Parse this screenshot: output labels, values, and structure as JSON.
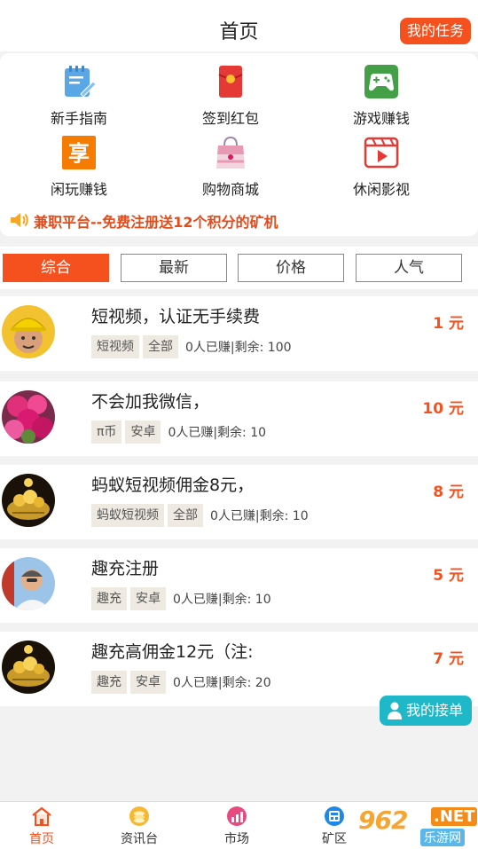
{
  "header": {
    "title": "首页",
    "task_button": "我的任务"
  },
  "menu": {
    "items": [
      {
        "label": "新手指南",
        "icon": "guide-icon"
      },
      {
        "label": "签到红包",
        "icon": "red-envelope-icon"
      },
      {
        "label": "游戏赚钱",
        "icon": "gamepad-icon"
      },
      {
        "label": "闲玩赚钱",
        "icon": "enjoy-icon"
      },
      {
        "label": "购物商城",
        "icon": "shopping-bag-icon"
      },
      {
        "label": "休闲影视",
        "icon": "video-icon"
      }
    ],
    "enjoy_glyph": "享"
  },
  "announcement": "兼职平台--免费注册送12个积分的矿机",
  "filters": {
    "tabs": [
      "综合",
      "最新",
      "价格",
      "人气"
    ],
    "active": "综合"
  },
  "tasks": [
    {
      "title": "短视频，认证无手续费",
      "price": "1 元",
      "tags": [
        "短视频",
        "全部"
      ],
      "stat": "0人已赚|剩余: 100"
    },
    {
      "title": "不会加我微信，",
      "price": "10 元",
      "tags": [
        "π币",
        "安卓"
      ],
      "stat": "0人已赚|剩余: 10"
    },
    {
      "title": "蚂蚁短视频佣金8元，",
      "price": "8 元",
      "tags": [
        "蚂蚁短视频",
        "全部"
      ],
      "stat": "0人已赚|剩余: 10"
    },
    {
      "title": "趣充注册",
      "price": "5 元",
      "tags": [
        "趣充",
        "安卓"
      ],
      "stat": "0人已赚|剩余: 10"
    },
    {
      "title": "趣充高佣金12元（注:",
      "price": "7 元",
      "tags": [
        "趣充",
        "安卓"
      ],
      "stat": "0人已赚|剩余: 20"
    }
  ],
  "floating_button": "我的接单",
  "bottom_nav": {
    "items": [
      {
        "label": "首页",
        "icon": "home-icon"
      },
      {
        "label": "资讯台",
        "icon": "coin-icon"
      },
      {
        "label": "市场",
        "icon": "chart-icon"
      },
      {
        "label": "矿区",
        "icon": "mine-icon"
      }
    ],
    "active": "首页"
  },
  "watermark": {
    "brand": "962",
    "net": ".NET",
    "sub": "乐游网"
  },
  "colors": {
    "accent": "#f4511e",
    "float_button": "#1fb8c8",
    "tag_bg": "#eeeae1"
  }
}
